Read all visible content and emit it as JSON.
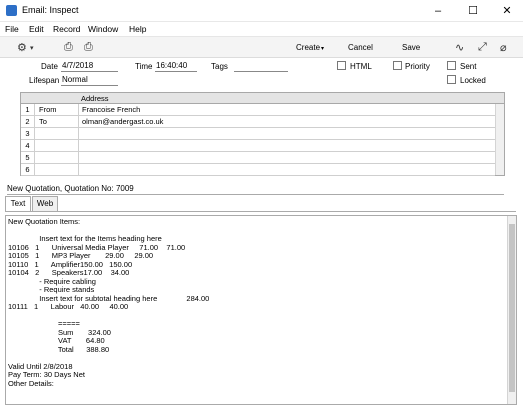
{
  "window": {
    "title": "Email: Inspect",
    "controls": [
      "–",
      "☐",
      "✕"
    ]
  },
  "menu": [
    "File",
    "Edit",
    "Record",
    "Window",
    "Help"
  ],
  "toolbar": {
    "create": "Create",
    "cancel": "Cancel",
    "save": "Save"
  },
  "header": {
    "date_label": "Date",
    "date_value": "4/7/2018",
    "time_label": "Time",
    "time_value": "16:40:40",
    "tags_label": "Tags",
    "tags_value": "",
    "lifespan_label": "Lifespan",
    "lifespan_value": "Normal",
    "html_label": "HTML",
    "priority_label": "Priority",
    "sent_label": "Sent",
    "locked_label": "Locked"
  },
  "grid": {
    "header": "Address",
    "rows": [
      {
        "n": "1",
        "type": "From",
        "address": "Francoise French"
      },
      {
        "n": "2",
        "type": "To",
        "address": "olman@andergast.co.uk"
      },
      {
        "n": "3",
        "type": "",
        "address": ""
      },
      {
        "n": "4",
        "type": "",
        "address": ""
      },
      {
        "n": "5",
        "type": "",
        "address": ""
      },
      {
        "n": "6",
        "type": "",
        "address": ""
      }
    ]
  },
  "subject": "New Quotation, Quotation No: 7009",
  "tabs": [
    "Text",
    "Web"
  ],
  "body": "New Quotation Items:\n\n               Insert text for the Items heading here\n10106   1      Universal Media Player     71.00    71.00\n10105   1      MP3 Player       29.00     29.00\n10110   1      Amplifier150.00   150.00\n10104   2      Speakers17.00    34.00\n               - Require cabling\n               - Require stands\n               Insert text for subtotal heading here              284.00\n10111   1      Labour   40.00     40.00\n\n                        =====\n                        Sum       324.00\n                        VAT       64.80\n                        Total      388.80\n\nValid Until 2/8/2018\nPay Term: 30 Days Net\nOther Details:"
}
